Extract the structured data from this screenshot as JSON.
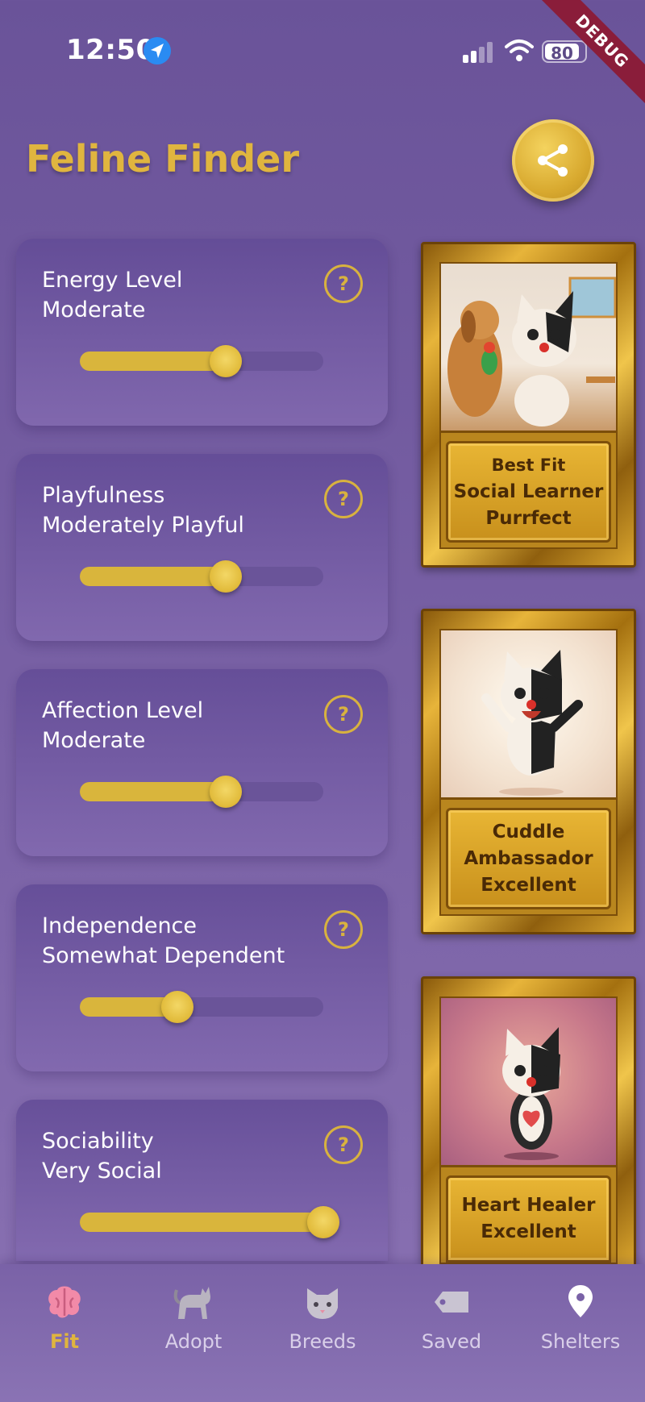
{
  "status_bar": {
    "time": "12:50",
    "battery": "80",
    "debug": "DEBUG"
  },
  "header": {
    "title": "Feline Finder"
  },
  "traits": [
    {
      "name": "Energy Level",
      "level": "Moderate",
      "value": 0.6
    },
    {
      "name": "Playfulness",
      "level": "Moderately Playful",
      "value": 0.6
    },
    {
      "name": "Affection Level",
      "level": "Moderate",
      "value": 0.6
    },
    {
      "name": "Independence",
      "level": "Somewhat Dependent",
      "value": 0.4
    },
    {
      "name": "Sociability",
      "level": "Very Social",
      "value": 1.0
    }
  ],
  "help_label": "?",
  "awards": [
    {
      "lines": [
        "Best Fit",
        "Social Learner",
        "Purrfect"
      ]
    },
    {
      "lines": [
        "Cuddle",
        "Ambassador",
        "Excellent"
      ]
    },
    {
      "lines": [
        "Heart Healer",
        "Excellent"
      ]
    }
  ],
  "nav": {
    "items": [
      {
        "label": "Fit",
        "icon": "brain-icon"
      },
      {
        "label": "Adopt",
        "icon": "cat-icon"
      },
      {
        "label": "Breeds",
        "icon": "cat-face-icon"
      },
      {
        "label": "Saved",
        "icon": "tag-icon"
      },
      {
        "label": "Shelters",
        "icon": "map-pin-icon"
      }
    ],
    "active": "Fit"
  },
  "colors": {
    "accent": "#e0b53f",
    "background": "#6a5399",
    "slider": "#d9b53c"
  }
}
